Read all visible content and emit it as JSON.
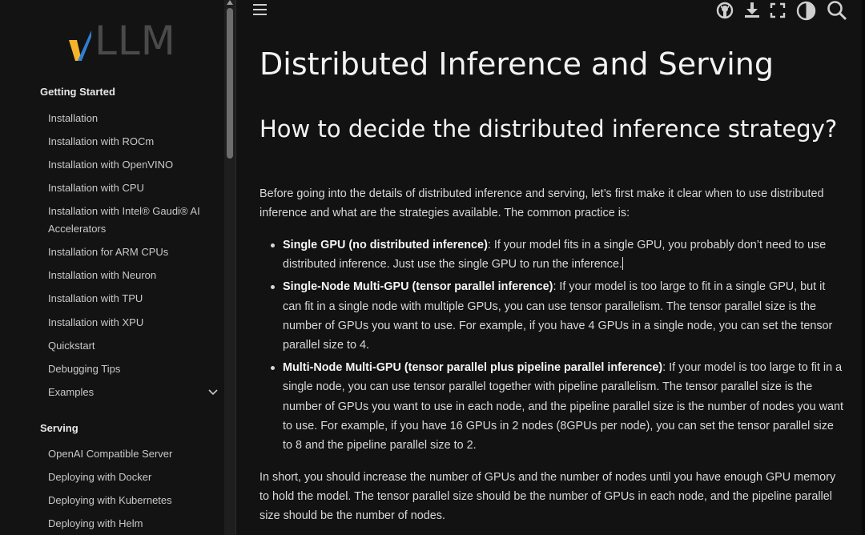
{
  "logo": {
    "text": "LLM",
    "mark_colors": [
      "#f4b42a",
      "#2f7fd3"
    ]
  },
  "sidebar": {
    "sections": [
      {
        "title": "Getting Started"
      },
      {
        "title": "Serving"
      }
    ],
    "getting_started_items": [
      "Installation",
      "Installation with ROCm",
      "Installation with OpenVINO",
      "Installation with CPU",
      "Installation with Intel® Gaudi® AI Accelerators",
      "Installation for ARM CPUs",
      "Installation with Neuron",
      "Installation with TPU",
      "Installation with XPU",
      "Quickstart",
      "Debugging Tips",
      "Examples"
    ],
    "serving_items": [
      "OpenAI Compatible Server",
      "Deploying with Docker",
      "Deploying with Kubernetes",
      "Deploying with Helm"
    ]
  },
  "header": {
    "icons": [
      "menu-icon",
      "github-icon",
      "download-icon",
      "fullscreen-icon",
      "theme-toggle-icon",
      "search-icon"
    ]
  },
  "main": {
    "title": "Distributed Inference and Serving",
    "subtitle": "How to decide the distributed inference strategy?",
    "intro": "Before going into the details of distributed inference and serving, let’s first make it clear when to use distributed inference and what are the strategies available. The common practice is:",
    "bullets": [
      {
        "bold": "Single GPU (no distributed inference)",
        "text": ": If your model fits in a single GPU, you probably don’t need to use distributed inference. Just use the single GPU to run the inference."
      },
      {
        "bold": "Single-Node Multi-GPU (tensor parallel inference)",
        "text": ": If your model is too large to fit in a single GPU, but it can fit in a single node with multiple GPUs, you can use tensor parallelism. The tensor parallel size is the number of GPUs you want to use. For example, if you have 4 GPUs in a single node, you can set the tensor parallel size to 4."
      },
      {
        "bold": "Multi-Node Multi-GPU (tensor parallel plus pipeline parallel inference)",
        "text": ": If your model is too large to fit in a single node, you can use tensor parallel together with pipeline parallelism. The tensor parallel size is the number of GPUs you want to use in each node, and the pipeline parallel size is the number of nodes you want to use. For example, if you have 16 GPUs in 2 nodes (8GPUs per node), you can set the tensor parallel size to 8 and the pipeline parallel size to 2."
      }
    ],
    "summary": "In short, you should increase the number of GPUs and the number of nodes until you have enough GPU memory to hold the model. The tensor parallel size should be the number of GPUs in each node, and the pipeline parallel size should be the number of nodes."
  }
}
